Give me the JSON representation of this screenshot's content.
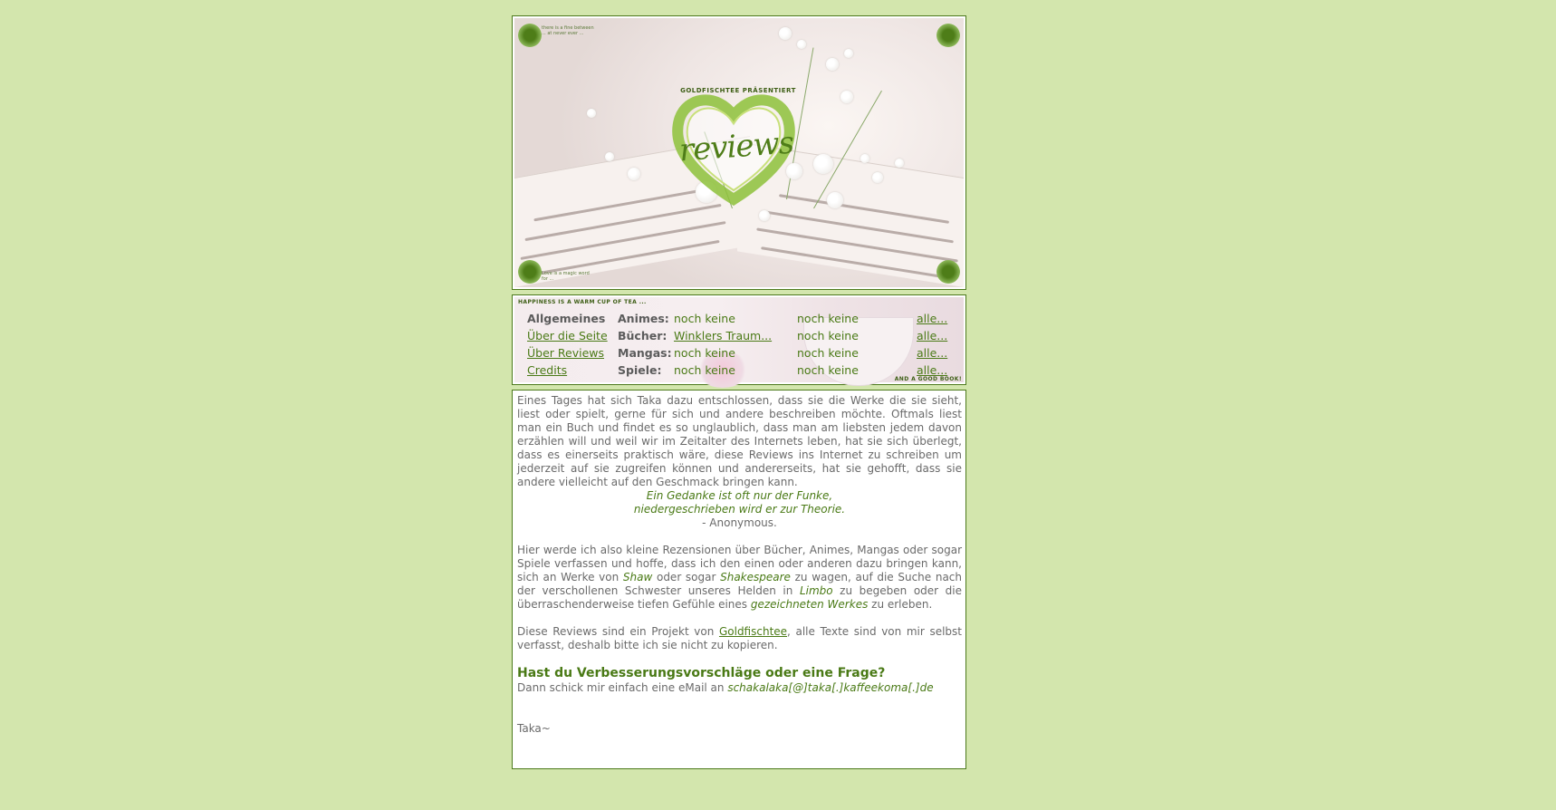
{
  "header": {
    "presents": "GOLDFISCHTEE PRÄSENTIERT",
    "logo_word": "reviews",
    "corner_tl": "there is a fine between ... at never ever ...",
    "corner_br": "Love is a magic word for ..."
  },
  "nav": {
    "tagline_top": "HAPPINESS IS A WARM CUP OF TEA ...",
    "tagline_bottom": "AND A GOOD BOOK!",
    "heading": "Allgemeines",
    "links": [
      "Über die Seite",
      "Über Reviews",
      "Credits"
    ],
    "rows": [
      {
        "category": "Animes:",
        "latest": "noch keine",
        "second": "noch keine",
        "all": "alle..."
      },
      {
        "category": "Bücher:",
        "latest": "Winklers Traum...",
        "second": "noch keine",
        "all": "alle..."
      },
      {
        "category": "Mangas:",
        "latest": "noch keine",
        "second": "noch keine",
        "all": "alle..."
      },
      {
        "category": "Spiele:",
        "latest": "noch keine",
        "second": "noch keine",
        "all": "alle..."
      }
    ]
  },
  "content": {
    "intro": "Eines Tages hat sich Taka dazu entschlossen, dass sie die Werke die sie sieht, liest oder spielt, gerne für sich und andere beschreiben möchte. Oftmals liest man ein Buch und findet es so unglaublich, dass man am liebsten jedem davon erzählen will und weil wir im Zeitalter des Internets leben, hat sie sich überlegt, dass es einerseits praktisch wäre, diese Reviews ins Internet zu schreiben um jederzeit auf sie zugreifen können und andererseits, hat sie gehofft, dass sie andere vielleicht auf den Geschmack bringen kann.",
    "quote_line1": "Ein Gedanke ist oft nur der Funke,",
    "quote_line2": "niedergeschrieben wird er zur Theorie.",
    "quote_author": "- Anonymous.",
    "p2_a": "Hier werde ich also kleine Rezensionen über Bücher, Animes, Mangas oder sogar Spiele verfassen und hoffe, dass ich den einen oder anderen dazu bringen kann, sich an Werke von ",
    "p2_shaw": "Shaw",
    "p2_b": " oder sogar ",
    "p2_shakespeare": "Shakespeare",
    "p2_c": " zu wagen, auf die Suche nach der verschollenen Schwester unseres Helden in ",
    "p2_limbo": "Limbo",
    "p2_d": " zu begeben oder die überraschenderweise tiefen Gefühle eines ",
    "p2_werkes": "gezeichneten Werkes",
    "p2_e": " zu erleben.",
    "p3_a": "Diese Reviews sind ein Projekt von ",
    "p3_link": "Goldfischtee",
    "p3_b": ", alle Texte sind von mir selbst verfasst, deshalb bitte ich sie nicht zu kopieren.",
    "question": "Hast du Verbesserungsvorschläge oder eine Frage?",
    "mail_text": "Dann schick mir einfach eine eMail an ",
    "mail_addr": "schakalaka[@]taka[.]kaffeekoma[.]de",
    "signature": "Taka~"
  },
  "colors": {
    "background": "#d3e6ad",
    "accent": "#4a7a16",
    "border": "#4d7a1c",
    "text": "#6a6a6a"
  }
}
